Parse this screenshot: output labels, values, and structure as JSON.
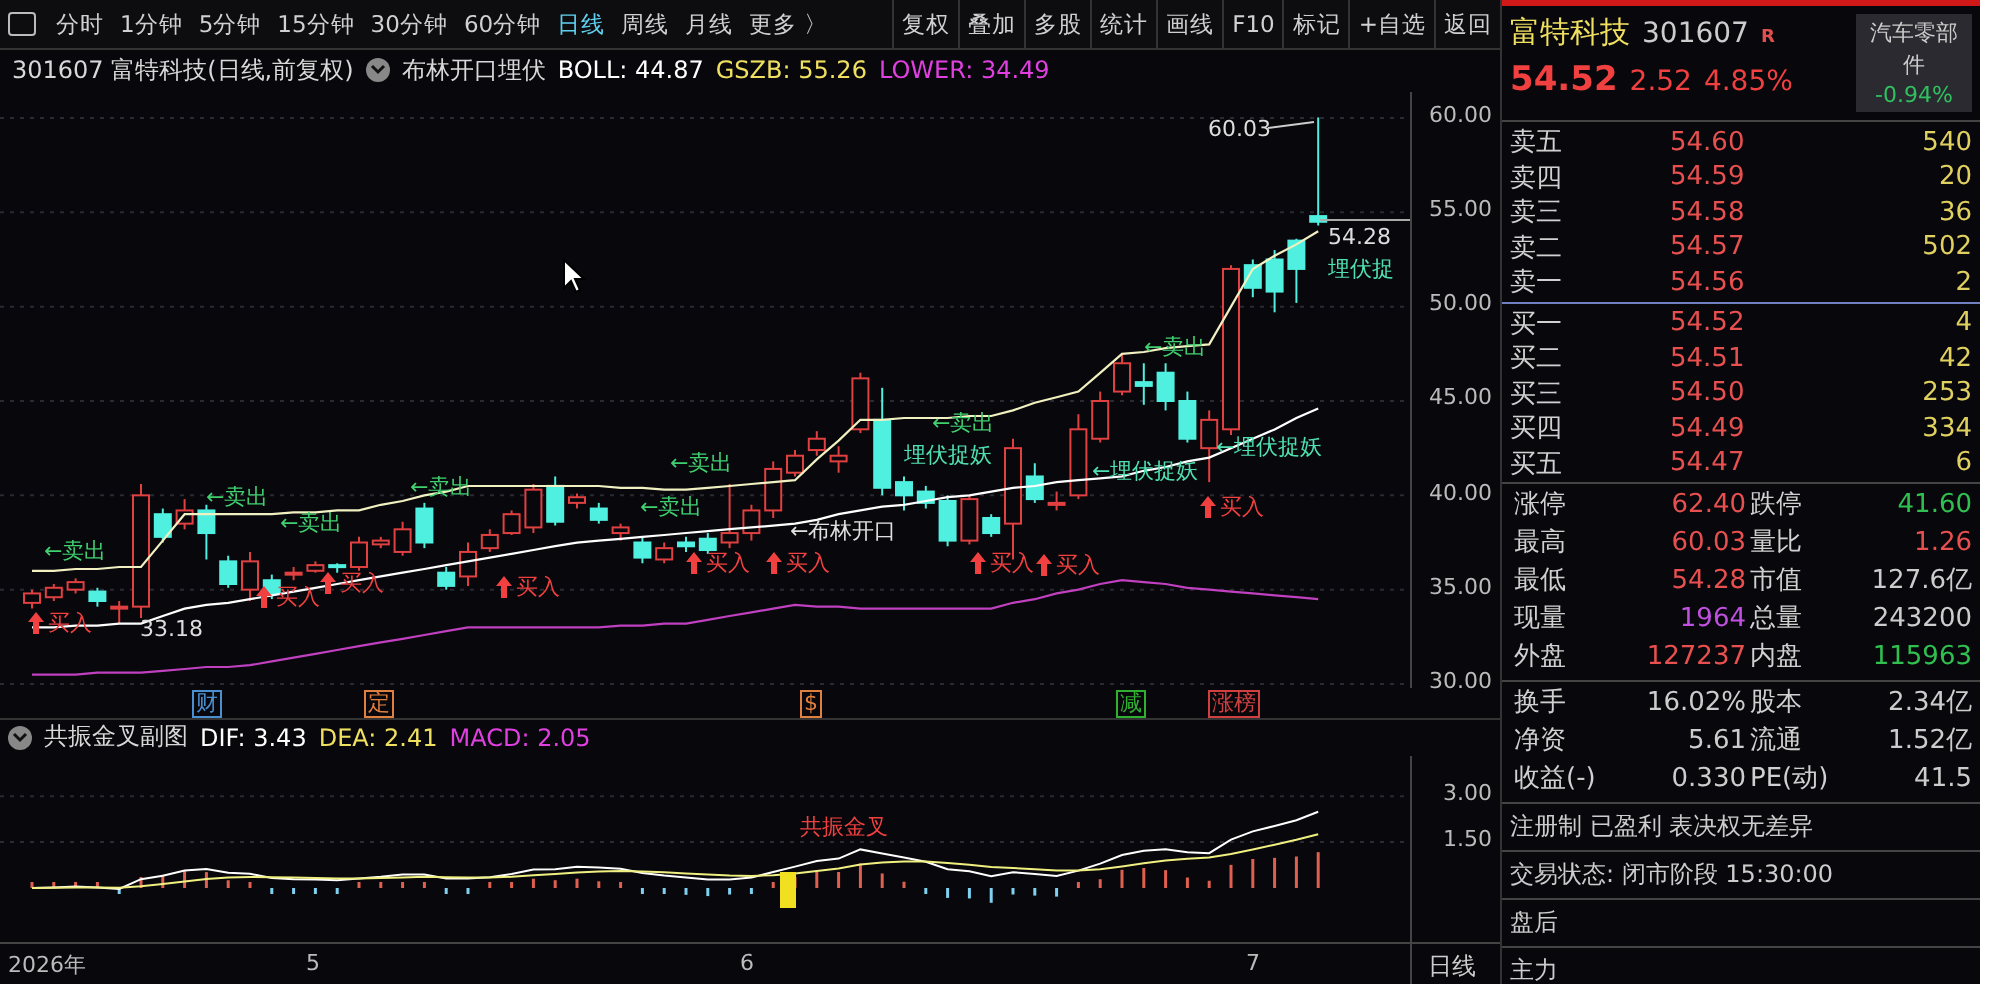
{
  "toolbar": {
    "periods": [
      {
        "label": "分时",
        "selected": false
      },
      {
        "label": "1分钟",
        "selected": false
      },
      {
        "label": "5分钟",
        "selected": false
      },
      {
        "label": "15分钟",
        "selected": false
      },
      {
        "label": "30分钟",
        "selected": false
      },
      {
        "label": "60分钟",
        "selected": false
      },
      {
        "label": "日线",
        "selected": true
      },
      {
        "label": "周线",
        "selected": false
      },
      {
        "label": "月线",
        "selected": false
      },
      {
        "label": "更多 〉",
        "selected": false
      }
    ],
    "actions": [
      "复权",
      "叠加",
      "多股",
      "统计",
      "画线",
      "F10",
      "标记",
      "+自选",
      "返回"
    ]
  },
  "chart_header": {
    "title": "301607 富特科技(日线,前复权)",
    "indicator": "布林开口埋伏",
    "boll": "BOLL: 44.87",
    "gszb": "GSZB: 55.26",
    "lower": "LOWER: 34.49"
  },
  "price_chart": {
    "chart_data": {
      "type": "candlestick",
      "ylim": [
        30,
        60
      ],
      "grid": true,
      "yticks": [
        {
          "value": 60,
          "label": "60.00"
        },
        {
          "value": 55,
          "label": "55.00"
        },
        {
          "value": 50,
          "label": "50.00"
        },
        {
          "value": 45,
          "label": "45.00"
        },
        {
          "value": 40,
          "label": "40.00"
        },
        {
          "value": 35,
          "label": "35.00"
        },
        {
          "value": 30,
          "label": "30.00"
        }
      ],
      "ohlc": [
        [
          34.3,
          35,
          34,
          34.8
        ],
        [
          34.6,
          35.3,
          34.4,
          35.1
        ],
        [
          35,
          35.6,
          34.8,
          35.4
        ],
        [
          34.9,
          35.1,
          34.1,
          34.4
        ],
        [
          34.0,
          34.4,
          33.2,
          34.1
        ],
        [
          34.1,
          40.6,
          33.5,
          40
        ],
        [
          39,
          39.3,
          37.5,
          37.8
        ],
        [
          38.5,
          39.8,
          38.2,
          39.2
        ],
        [
          39.2,
          39.5,
          36.6,
          38.0
        ],
        [
          36.5,
          36.8,
          35.1,
          35.3
        ],
        [
          35,
          37,
          34.4,
          36.5
        ],
        [
          35.5,
          35.8,
          34.5,
          34.8
        ],
        [
          35.8,
          36.2,
          35.5,
          35.9
        ],
        [
          36,
          36.5,
          35.9,
          36.3
        ],
        [
          36.3,
          36.4,
          35.9,
          36.2
        ],
        [
          36.2,
          37.8,
          36,
          37.5
        ],
        [
          37.4,
          37.8,
          37.2,
          37.6
        ],
        [
          37,
          38.6,
          36.8,
          38.2
        ],
        [
          39.3,
          39.6,
          37.2,
          37.5
        ],
        [
          35.9,
          36.2,
          35,
          35.2
        ],
        [
          35.7,
          37.5,
          35.2,
          37
        ],
        [
          37.2,
          38.2,
          37,
          37.9
        ],
        [
          38,
          39.2,
          37.9,
          39
        ],
        [
          38.3,
          40.6,
          38,
          40.3
        ],
        [
          40.5,
          41,
          38.4,
          38.6
        ],
        [
          39.6,
          40.1,
          39.3,
          39.9
        ],
        [
          39.3,
          39.6,
          38.5,
          38.7
        ],
        [
          38,
          38.5,
          37.6,
          38.3
        ],
        [
          37.5,
          37.8,
          36.4,
          36.7
        ],
        [
          36.6,
          37.5,
          36.4,
          37.2
        ],
        [
          37.5,
          37.8,
          37,
          37.3
        ],
        [
          37.7,
          38,
          36.9,
          37.1
        ],
        [
          37.5,
          40.6,
          37.2,
          38
        ],
        [
          38,
          39.5,
          37.6,
          39.2
        ],
        [
          39.2,
          41.8,
          38.8,
          41.4
        ],
        [
          41.2,
          42.4,
          41,
          42.1
        ],
        [
          42.4,
          43.4,
          42.1,
          43
        ],
        [
          41.8,
          42.6,
          41.2,
          42.1
        ],
        [
          43.5,
          46.5,
          43.3,
          46.2
        ],
        [
          44,
          45.7,
          40,
          40.4
        ],
        [
          40.7,
          41,
          39.2,
          40
        ],
        [
          40.2,
          40.5,
          39.3,
          39.6
        ],
        [
          39.7,
          40,
          37.3,
          37.6
        ],
        [
          37.6,
          40,
          37.4,
          39.8
        ],
        [
          38.8,
          39,
          37.8,
          38
        ],
        [
          38.5,
          43,
          36.6,
          42.5
        ],
        [
          41,
          41.7,
          39.6,
          39.8
        ],
        [
          39.5,
          40.2,
          39.2,
          39.6
        ],
        [
          40,
          44.3,
          39.8,
          43.5
        ],
        [
          43,
          45.5,
          42.8,
          45
        ],
        [
          45.5,
          47.5,
          45.3,
          47
        ],
        [
          46,
          47,
          44.8,
          45.8
        ],
        [
          46.5,
          47,
          44.5,
          45
        ],
        [
          45,
          45.5,
          42.8,
          43
        ],
        [
          42.5,
          44.5,
          40.7,
          44.0
        ],
        [
          43.5,
          52.2,
          43.2,
          52
        ],
        [
          52.2,
          52.5,
          50.5,
          51
        ],
        [
          52.5,
          53,
          49.7,
          50.8
        ],
        [
          53.5,
          53.6,
          50.2,
          52
        ],
        [
          54.8,
          60.03,
          54.3,
          54.5
        ]
      ],
      "series": [
        {
          "type": "line",
          "color": "#f0f0c0",
          "values": [
            36.0,
            36.0,
            36.1,
            36.1,
            36.2,
            36.2,
            37.6,
            39.0,
            39.0,
            39.0,
            39.0,
            39.0,
            39.1,
            39.1,
            39.2,
            39.2,
            39.5,
            39.7,
            40.0,
            40.2,
            40.5,
            40.5,
            40.5,
            40.5,
            40.5,
            40.5,
            40.5,
            40.4,
            40.4,
            40.3,
            40.3,
            40.4,
            40.5,
            40.6,
            40.7,
            40.8,
            41.9,
            42.9,
            44.0,
            44.0,
            44.1,
            44.1,
            44.1,
            44.2,
            44.2,
            44.5,
            44.9,
            45.2,
            45.5,
            46.5,
            47.5,
            47.6,
            47.8,
            47.9,
            48.0,
            50.0,
            52.0,
            52.7,
            53.3,
            54.0
          ]
        },
        {
          "type": "line",
          "color": "#ffffff",
          "values": [
            33.0,
            33.0,
            33.1,
            33.1,
            33.2,
            33.2,
            33.6,
            34.0,
            34.2,
            34.3,
            34.5,
            34.7,
            34.9,
            35.1,
            35.3,
            35.5,
            35.7,
            35.9,
            36.1,
            36.3,
            36.5,
            36.7,
            36.9,
            37.1,
            37.3,
            37.5,
            37.6,
            37.7,
            37.8,
            37.9,
            38.0,
            38.1,
            38.2,
            38.3,
            38.4,
            38.5,
            38.7,
            39.0,
            39.2,
            39.4,
            39.5,
            39.7,
            39.9,
            40.0,
            40.2,
            40.4,
            40.5,
            40.7,
            40.8,
            40.9,
            41.0,
            41.3,
            41.5,
            41.8,
            42.0,
            42.5,
            43.0,
            43.5,
            44.1,
            44.6
          ]
        },
        {
          "type": "line",
          "color": "#c040c0",
          "values": [
            30.5,
            30.5,
            30.5,
            30.6,
            30.6,
            30.6,
            30.7,
            30.8,
            30.9,
            30.9,
            31.0,
            31.2,
            31.4,
            31.6,
            31.8,
            32.0,
            32.2,
            32.4,
            32.6,
            32.8,
            33.0,
            33.0,
            33.0,
            33.0,
            33.0,
            33.0,
            33.0,
            33.1,
            33.1,
            33.2,
            33.2,
            33.4,
            33.6,
            33.8,
            34.0,
            34.2,
            34.1,
            34.1,
            34.0,
            34.0,
            34.0,
            34.0,
            34.0,
            34.0,
            34.0,
            34.3,
            34.5,
            34.8,
            35.0,
            35.3,
            35.5,
            35.4,
            35.3,
            35.1,
            35.0,
            34.9,
            34.8,
            34.7,
            34.6,
            34.5
          ]
        }
      ]
    }
  },
  "annotations": {
    "high": "60.03",
    "low": "33.18",
    "last": "54.28"
  },
  "signals": [
    {
      "kind": "sell",
      "label": "←卖出"
    },
    {
      "kind": "sell",
      "label": "←卖出"
    },
    {
      "kind": "sell",
      "label": "←卖出"
    },
    {
      "kind": "sell",
      "label": "←卖出"
    },
    {
      "kind": "sell",
      "label": "←卖出"
    },
    {
      "kind": "sell",
      "label": "←卖出"
    },
    {
      "kind": "sell",
      "label": "←卖出"
    },
    {
      "kind": "sell",
      "label": "←卖出"
    },
    {
      "kind": "buy",
      "label": "买入"
    },
    {
      "kind": "buy",
      "label": "买入"
    },
    {
      "kind": "buy",
      "label": "买入"
    },
    {
      "kind": "buy",
      "label": "买入"
    },
    {
      "kind": "buy",
      "label": "买入"
    },
    {
      "kind": "buy",
      "label": "买入"
    },
    {
      "kind": "buy",
      "label": "买入"
    },
    {
      "kind": "buy",
      "label": "买入"
    },
    {
      "kind": "buy",
      "label": "买入"
    },
    {
      "kind": "note",
      "label": "←布林开口"
    },
    {
      "kind": "hunt",
      "label": "埋伏捉妖"
    },
    {
      "kind": "hunt",
      "label": "←埋伏捉妖"
    },
    {
      "kind": "hunt",
      "label": "←埋伏捉妖"
    },
    {
      "kind": "hunt",
      "label": "埋伏捉"
    }
  ],
  "events": [
    {
      "label": "财",
      "color": "#4a8fd0"
    },
    {
      "label": "定",
      "color": "#e08040"
    },
    {
      "label": "$",
      "color": "#e08040"
    },
    {
      "label": "减",
      "color": "#30b030"
    },
    {
      "label": "涨榜",
      "color": "#d04040"
    }
  ],
  "sub_chart": {
    "title": "共振金叉副图",
    "dif": "DIF: 3.43",
    "dea": "DEA: 2.41",
    "macd": "MACD: 2.05",
    "axis": [
      "3.00",
      "1.50"
    ],
    "signal": "共振金叉"
  },
  "time_axis": [
    "2026年",
    "5",
    "6",
    "7"
  ],
  "period_label": "日线",
  "quote": {
    "name": "富特科技",
    "code": "301607",
    "badge": "R",
    "price": "54.52",
    "change": "2.52",
    "percent": "4.85%",
    "sector": {
      "name": "汽车零部件",
      "change": "-0.94%"
    },
    "asks": [
      {
        "label": "卖五",
        "price": "54.60",
        "volume": "540"
      },
      {
        "label": "卖四",
        "price": "54.59",
        "volume": "20"
      },
      {
        "label": "卖三",
        "price": "54.58",
        "volume": "36"
      },
      {
        "label": "卖二",
        "price": "54.57",
        "volume": "502"
      },
      {
        "label": "卖一",
        "price": "54.56",
        "volume": "2"
      }
    ],
    "bids": [
      {
        "label": "买一",
        "price": "54.52",
        "volume": "4"
      },
      {
        "label": "买二",
        "price": "54.51",
        "volume": "42"
      },
      {
        "label": "买三",
        "price": "54.50",
        "volume": "253"
      },
      {
        "label": "买四",
        "price": "54.49",
        "volume": "334"
      },
      {
        "label": "买五",
        "price": "54.47",
        "volume": "6"
      }
    ],
    "stats": [
      {
        "label": "涨停",
        "value": "62.40",
        "color": "#e85050"
      },
      {
        "label": "跌停",
        "value": "41.60",
        "color": "#30c050"
      },
      {
        "label": "最高",
        "value": "60.03",
        "color": "#e85050"
      },
      {
        "label": "量比",
        "value": "1.26",
        "color": "#e85050"
      },
      {
        "label": "最低",
        "value": "54.28",
        "color": "#e85050"
      },
      {
        "label": "市值",
        "value": "127.6亿",
        "color": "#cccccc"
      },
      {
        "label": "现量",
        "value": "1964",
        "color": "#c050e0"
      },
      {
        "label": "总量",
        "value": "243200",
        "color": "#cccccc"
      },
      {
        "label": "外盘",
        "value": "127237",
        "color": "#e85050"
      },
      {
        "label": "内盘",
        "value": "115963",
        "color": "#30c050"
      }
    ],
    "fundamentals": [
      {
        "label": "换手",
        "value": "16.02%"
      },
      {
        "label": "股本",
        "value": "2.34亿"
      },
      {
        "label": "净资",
        "value": "5.61"
      },
      {
        "label": "流通",
        "value": "1.52亿"
      },
      {
        "label": "收益(-)",
        "value": "0.330"
      },
      {
        "label": "PE(动)",
        "value": "41.5"
      }
    ],
    "tags": "注册制 已盈利 表决权无差异",
    "status": "交易状态: 闭市阶段 15:30:00",
    "more": [
      "盘后",
      "主力"
    ]
  }
}
